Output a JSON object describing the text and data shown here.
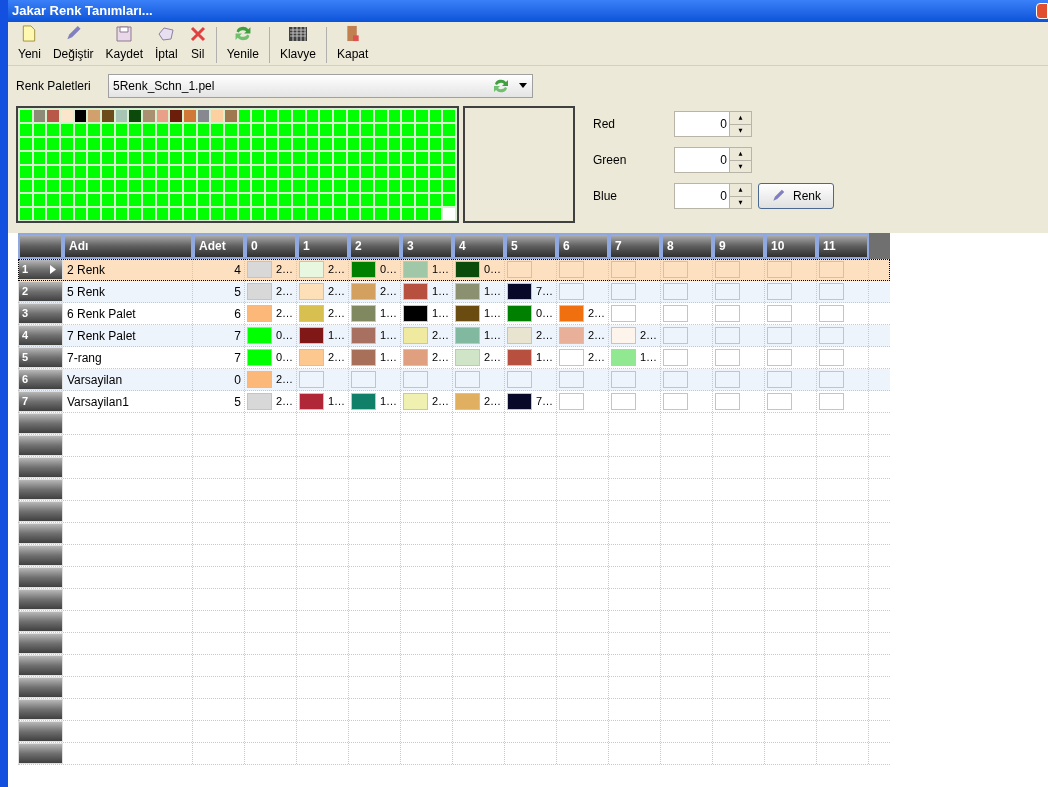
{
  "window": {
    "title": "Jakar Renk Tanımları..."
  },
  "toolbar": [
    {
      "kind": "new",
      "label": "Yeni"
    },
    {
      "kind": "edit",
      "label": "Değiştir"
    },
    {
      "kind": "save",
      "label": "Kaydet"
    },
    {
      "kind": "cancel",
      "label": "İptal"
    },
    {
      "kind": "delete",
      "label": "Sil",
      "sep": true
    },
    {
      "kind": "refresh",
      "label": "Yenile",
      "sep": true
    },
    {
      "kind": "keyboard",
      "label": "Klavye",
      "sep": true
    },
    {
      "kind": "close",
      "label": "Kapat"
    }
  ],
  "palette_selector": {
    "label": "Renk Paletleri",
    "value": "5Renk_Schn_1.pel"
  },
  "palette": {
    "swatches": [
      {
        "color": "#00ff00"
      },
      {
        "color": "#8d8a78"
      },
      {
        "color": "#b85848"
      },
      {
        "color": "#fbe6cc"
      },
      {
        "color": "#000000"
      },
      {
        "color": "#d2a06c"
      },
      {
        "color": "#6b4c1a"
      },
      {
        "color": "#a8c4b4"
      },
      {
        "color": "#0b4a0b"
      },
      {
        "color": "#a89070"
      },
      {
        "color": "#e8a088"
      },
      {
        "color": "#6b1e0a"
      },
      {
        "color": "#d07838"
      },
      {
        "color": "#888890"
      },
      {
        "color": "#fcd0a0"
      },
      {
        "color": "#a07850"
      }
    ],
    "filler": {
      "color": "#00ff00"
    },
    "last": {
      "color": "#ffffff"
    }
  },
  "rgb": [
    {
      "label": "Red",
      "value": "0"
    },
    {
      "label": "Green",
      "value": "0"
    },
    {
      "label": "Blue",
      "value": "0"
    }
  ],
  "color_button": "Renk",
  "table": {
    "columns": [
      "Adı",
      "Adet",
      "0",
      "1",
      "2",
      "3",
      "4",
      "5",
      "6",
      "7",
      "8",
      "9",
      "10",
      "11"
    ],
    "rows": [
      {
        "number": "1",
        "current": true,
        "selected": true,
        "name": "2 Renk",
        "count": "4",
        "cells": [
          {
            "color": "#d8d8d8",
            "text": "2…"
          },
          {
            "color": "#e8f8e0",
            "text": "2…"
          },
          {
            "color": "#008000",
            "text": "0…"
          },
          {
            "color": "#a0c8a8",
            "text": "1…"
          },
          {
            "color": "#0a4a0a",
            "text": "0…"
          }
        ]
      },
      {
        "number": "2",
        "current": false,
        "selected": false,
        "name": "5 Renk",
        "count": "5",
        "cells": [
          {
            "color": "#d8d8d8",
            "text": "2…"
          },
          {
            "color": "#fde0b8",
            "text": "2…"
          },
          {
            "color": "#d4a060",
            "text": "2…"
          },
          {
            "color": "#b85040",
            "text": "1…"
          },
          {
            "color": "#8a9070",
            "text": "1…"
          },
          {
            "color": "#080828",
            "text": "7…"
          }
        ]
      },
      {
        "number": "3",
        "current": false,
        "selected": false,
        "name": "6 Renk Palet",
        "count": "6",
        "cells": [
          {
            "color": "#fcb878",
            "text": "2…"
          },
          {
            "color": "#d8c050",
            "text": "2…"
          },
          {
            "color": "#808860",
            "text": "1…"
          },
          {
            "color": "#000000",
            "text": "1…"
          },
          {
            "color": "#6b4c10",
            "text": "1…"
          },
          {
            "color": "#008000",
            "text": "0…"
          },
          {
            "color": "#f07010",
            "text": "2…"
          }
        ]
      },
      {
        "number": "4",
        "current": false,
        "selected": false,
        "name": "7 Renk Palet",
        "count": "7",
        "cells": [
          {
            "color": "#00ff00",
            "text": "0…"
          },
          {
            "color": "#801818",
            "text": "1…"
          },
          {
            "color": "#a87060",
            "text": "1…"
          },
          {
            "color": "#f0eaa0",
            "text": "2…"
          },
          {
            "color": "#80b8a0",
            "text": "1…"
          },
          {
            "color": "#e8e4d0",
            "text": "2…"
          },
          {
            "color": "#e8b098",
            "text": "2…"
          },
          {
            "color": "#fdf4ec",
            "text": "2…"
          }
        ]
      },
      {
        "number": "5",
        "current": false,
        "selected": false,
        "name": "7-rang",
        "count": "7",
        "cells": [
          {
            "color": "#00ff00",
            "text": "0…"
          },
          {
            "color": "#fcc890",
            "text": "2…"
          },
          {
            "color": "#a87058",
            "text": "1…"
          },
          {
            "color": "#e0a080",
            "text": "2…"
          },
          {
            "color": "#d0e4c8",
            "text": "2…"
          },
          {
            "color": "#b85040",
            "text": "1…"
          },
          {
            "color": "#ffffff",
            "text": "2…"
          },
          {
            "color": "#90e890",
            "text": "1…"
          }
        ]
      },
      {
        "number": "6",
        "current": false,
        "selected": false,
        "name": "Varsayilan",
        "count": "0",
        "cells": [
          {
            "color": "#fcb878",
            "text": "2…"
          }
        ]
      },
      {
        "number": "7",
        "current": false,
        "selected": false,
        "name": "Varsayilan1",
        "count": "5",
        "cells": [
          {
            "color": "#d8d8d8",
            "text": "2…"
          },
          {
            "color": "#b02838",
            "text": "1…"
          },
          {
            "color": "#108068",
            "text": "1…"
          },
          {
            "color": "#f0f0b0",
            "text": "2…"
          },
          {
            "color": "#e0b060",
            "text": "2…"
          },
          {
            "color": "#080828",
            "text": "7…"
          }
        ]
      }
    ]
  }
}
